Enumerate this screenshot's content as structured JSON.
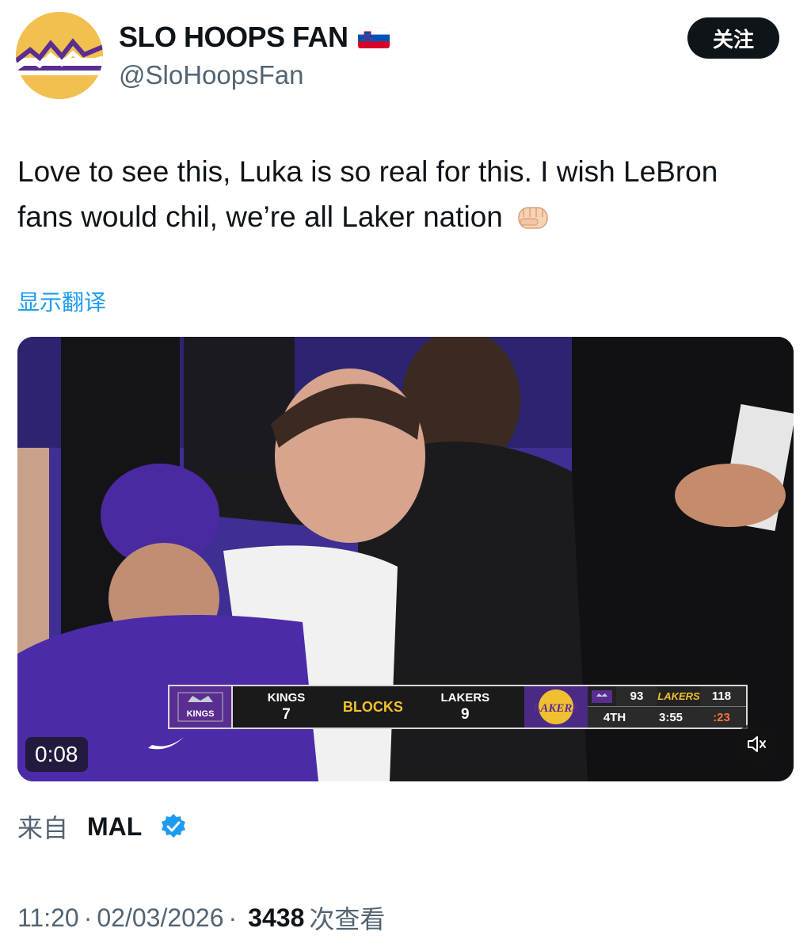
{
  "author": {
    "display_name": "SLO HOOPS FAN",
    "handle": "@SloHoopsFan",
    "flag_icon": "slovenia-flag-icon",
    "avatar_colors": {
      "background": "#f2c04e",
      "stripe": "#5a2d91"
    }
  },
  "actions": {
    "follow_label": "关注"
  },
  "tweet": {
    "text": "Love to see this, Luka is so real for this. I wish LeBron fans would chil, we’re all Laker nation",
    "trailing_emoji": "fist-bump-icon",
    "translate_label": "显示翻译"
  },
  "video": {
    "timestamp": "0:08",
    "mute_icon": "muted-speaker-icon",
    "scoreboard": {
      "stat_label": "BLOCKS",
      "team_left": {
        "name": "KINGS",
        "value": "7"
      },
      "team_right": {
        "name": "LAKERS",
        "value": "9"
      },
      "score": {
        "kings_score": "93",
        "lakers_logo_text": "LAKERS",
        "lakers_score": "118",
        "quarter": "4TH",
        "clock": "3:55",
        "shot_clock": ":23"
      },
      "kings_logo_text": "KINGS",
      "lakers_logo_text": "LAKERS"
    }
  },
  "source": {
    "prefix": "来自",
    "name": "MAL",
    "verified_icon": "verified-badge-icon"
  },
  "meta": {
    "time": "11:20",
    "date": "02/03/2026",
    "separator": "·",
    "views": "3438",
    "views_label": "次查看"
  },
  "colors": {
    "accent": "#1d9bf0",
    "lakers_purple": "#5a2d91",
    "lakers_gold": "#f0c030"
  }
}
